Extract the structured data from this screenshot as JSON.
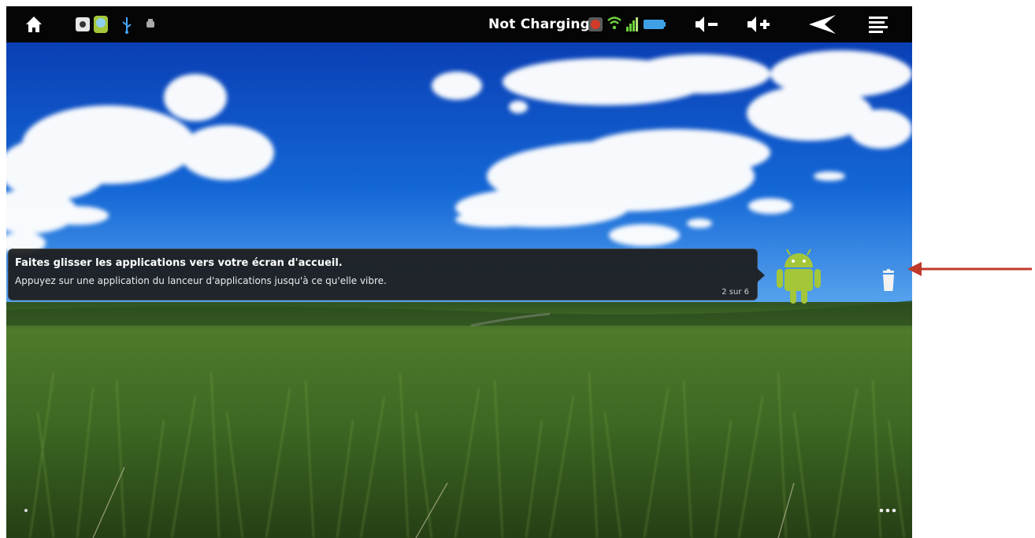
{
  "statusbar": {
    "charging_text": "Not Charging",
    "icons": [
      "home-icon",
      "notification-app-icon",
      "android-notification-icon",
      "usb-icon",
      "debug-icon",
      "battery-saver-icon",
      "wifi-icon",
      "signal-icon",
      "battery-icon",
      "volume-down-icon",
      "volume-up-icon",
      "back-icon",
      "menu-icon"
    ]
  },
  "tooltip": {
    "title": "Faites glisser les applications vers votre écran d'accueil.",
    "body": "Appuyez sur une application du lanceur d'applications jusqu'à ce qu'elle vibre.",
    "page": "2 sur 6"
  },
  "colors": {
    "sky": "#0b4fc1",
    "grass": "#3d6a24",
    "statusbar": "#050505",
    "android_green": "#a4c639",
    "arrow": "#c0392b"
  }
}
